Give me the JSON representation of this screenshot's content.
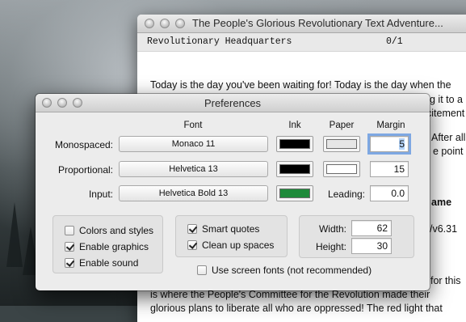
{
  "main_window": {
    "title": "The People's Glorious Revolutionary Text Adventure...",
    "status_location": "Revolutionary Headquarters",
    "status_score": "0/1",
    "story_first_line": "Today is the day you've been waiting for! Today is the day when the",
    "visible_fragments": {
      "line2_tail": "g it to a",
      "line3_tail": "citement",
      "line4_tail": "After all,",
      "line5_tail": "e point is",
      "heading_tail": "ame",
      "version_tail": "/v6.31",
      "line_for_this": "for this",
      "bottom_line1": "is where the People's Committee for the Revolution made their",
      "bottom_line2": "glorious plans to liberate all who are oppressed! The red light that"
    }
  },
  "preferences": {
    "title": "Preferences",
    "columns": {
      "font": "Font",
      "ink": "Ink",
      "paper": "Paper",
      "margin": "Margin"
    },
    "rows": {
      "monospaced": {
        "label": "Monospaced:",
        "font": "Monaco 11",
        "ink_color": "#000000",
        "paper_color": "#e6e6e6",
        "margin": "5"
      },
      "proportional": {
        "label": "Proportional:",
        "font": "Helvetica 13",
        "ink_color": "#000000",
        "paper_color": "#ffffff",
        "margin": "15"
      },
      "input": {
        "label": "Input:",
        "font": "Helvetica Bold 13",
        "ink_color": "#1e8a3a",
        "leading_label": "Leading:",
        "leading": "0.0"
      }
    },
    "options_left": [
      {
        "label": "Colors and styles",
        "checked": false
      },
      {
        "label": "Enable graphics",
        "checked": true
      },
      {
        "label": "Enable sound",
        "checked": true
      }
    ],
    "options_middle": [
      {
        "label": "Smart quotes",
        "checked": true
      },
      {
        "label": "Clean up spaces",
        "checked": true
      }
    ],
    "size": {
      "width_label": "Width:",
      "width": "62",
      "height_label": "Height:",
      "height": "30"
    },
    "screen_fonts": {
      "label": "Use screen fonts (not recommended)",
      "checked": false
    }
  }
}
